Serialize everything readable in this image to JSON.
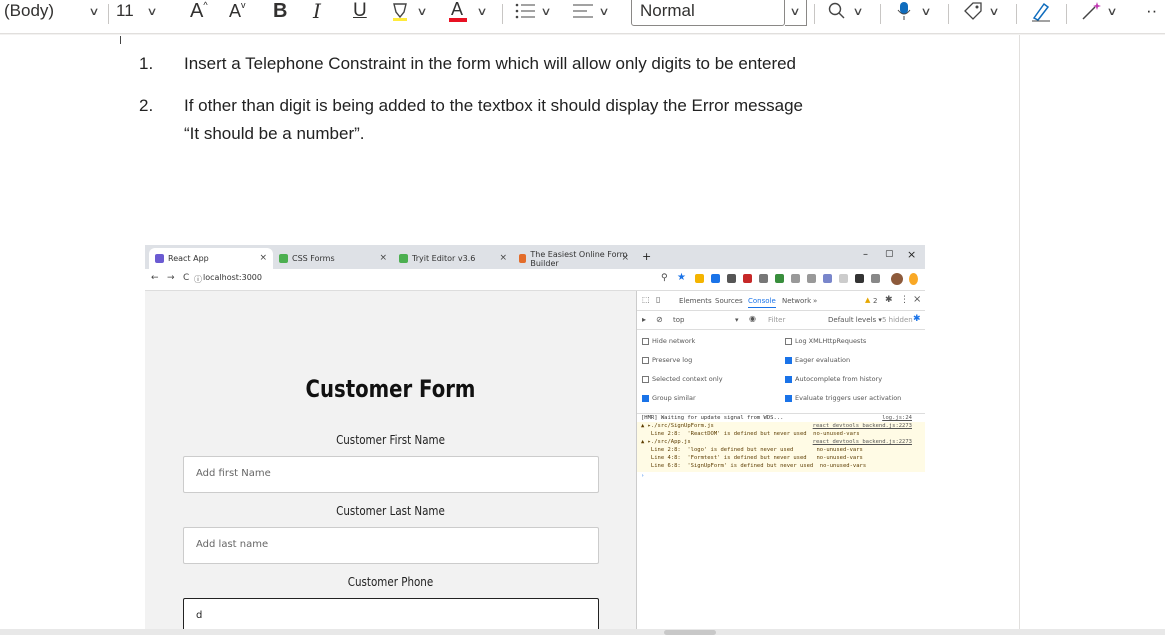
{
  "ribbon": {
    "font_name": "(Body)",
    "font_size": "11",
    "grow_font": "A",
    "shrink_font": "A",
    "bold": "B",
    "italic": "I",
    "underline": "U",
    "style_name": "Normal"
  },
  "document": {
    "items": [
      {
        "num": "1.",
        "text": "Insert a Telephone Constraint in the form which will allow only digits to be entered"
      },
      {
        "num": "2.",
        "text": "If other than digit is being added to the textbox it should display the Error message",
        "text2": "“It should be a number”."
      }
    ]
  },
  "browser": {
    "tabs": [
      {
        "title": "React App",
        "active": true,
        "color": "#6b5bd2"
      },
      {
        "title": "CSS Forms",
        "active": false,
        "color": "#4caf50"
      },
      {
        "title": "Tryit Editor v3.6",
        "active": false,
        "color": "#4caf50"
      },
      {
        "title": "The Easiest Online Form Builder",
        "active": false,
        "color": "#e36c2a"
      }
    ],
    "new_tab": "+",
    "window_min": "–",
    "window_max": "▢",
    "window_close": "×",
    "address": "localhost:3000"
  },
  "form": {
    "title": "Customer Form",
    "fields": [
      {
        "label": "Customer First Name",
        "placeholder": "Add first Name",
        "value": ""
      },
      {
        "label": "Customer Last Name",
        "placeholder": "Add last name",
        "value": ""
      },
      {
        "label": "Customer Phone",
        "placeholder": "",
        "value": "d"
      }
    ]
  },
  "devtools": {
    "tabs": [
      "Elements",
      "Sources",
      "Console",
      "Network",
      "»"
    ],
    "active_tab": "Console",
    "warnings_badge": "2",
    "context": "top",
    "filter_placeholder": "Filter",
    "levels": "Default levels ▾",
    "hidden": "5 hidden",
    "options_left": [
      {
        "label": "Hide network",
        "checked": false
      },
      {
        "label": "Preserve log",
        "checked": false
      },
      {
        "label": "Selected context only",
        "checked": false
      },
      {
        "label": "Group similar",
        "checked": true
      }
    ],
    "options_right": [
      {
        "label": "Log XMLHttpRequests",
        "checked": false
      },
      {
        "label": "Eager evaluation",
        "checked": true
      },
      {
        "label": "Autocomplete from history",
        "checked": true
      },
      {
        "label": "Evaluate triggers user activation",
        "checked": true
      }
    ],
    "console_lines": [
      {
        "text": "[HMR] Waiting for update signal from WDS...",
        "src": "log.js:24",
        "warn": false
      },
      {
        "text": "▲ ▸./src/SignUpForm.js",
        "src": "react_devtools_backend.js:2273",
        "warn": true
      },
      {
        "text": "   Line 2:8:  'ReactDOM' is defined but never used  no-unused-vars",
        "src": "",
        "warn": true
      },
      {
        "text": "▲ ▸./src/App.js",
        "src": "react_devtools_backend.js:2273",
        "warn": true
      },
      {
        "text": "   Line 2:8:  'logo' is defined but never used       no-unused-vars",
        "src": "",
        "warn": true
      },
      {
        "text": "   Line 4:8:  'Formtest' is defined but never used   no-unused-vars",
        "src": "",
        "warn": true
      },
      {
        "text": "   Line 6:8:  'SignUpForm' is defined but never used  no-unused-vars",
        "src": "",
        "warn": true
      },
      {
        "text": "›",
        "src": "",
        "warn": false
      }
    ]
  }
}
